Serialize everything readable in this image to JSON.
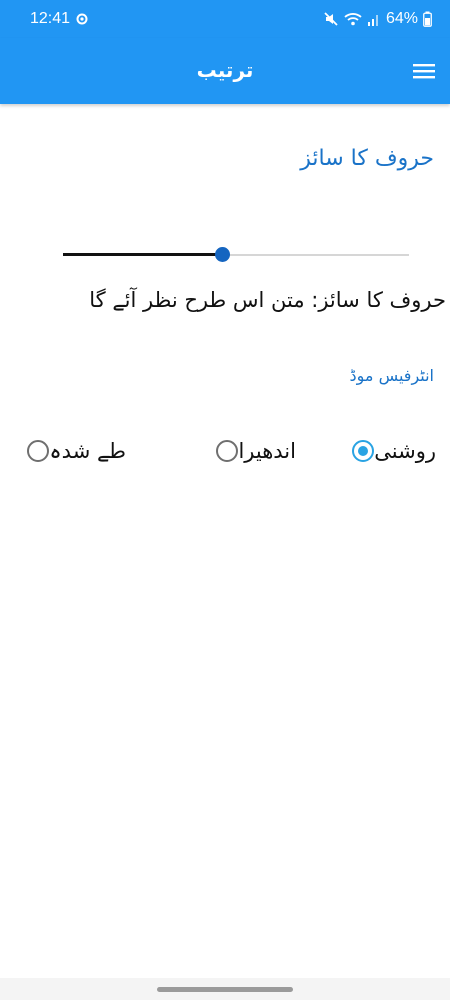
{
  "status_bar": {
    "time": "12:41",
    "battery": "64%",
    "icons": [
      "settings-gear-icon",
      "mute-icon",
      "wifi-icon",
      "signal-icon",
      "battery-icon"
    ]
  },
  "app_bar": {
    "title": "ترتیب",
    "menu_icon": "hamburger-menu-icon"
  },
  "font_size": {
    "title": "حروف کا سائز",
    "slider_value": 0.46,
    "preview": "حروف کا سائز: متن اس طرح نظر آئے گا"
  },
  "interface_mode": {
    "title": "انٹرفیس موڈ",
    "options": [
      {
        "label": "روشنی",
        "checked": true
      },
      {
        "label": "اندھیرا",
        "checked": false
      },
      {
        "label": "طے شدہ",
        "checked": false
      }
    ]
  },
  "colors": {
    "primary": "#2196f3",
    "accent": "#1a73c8",
    "radio_checked": "#29a3e3",
    "slider_thumb": "#1565c0"
  }
}
